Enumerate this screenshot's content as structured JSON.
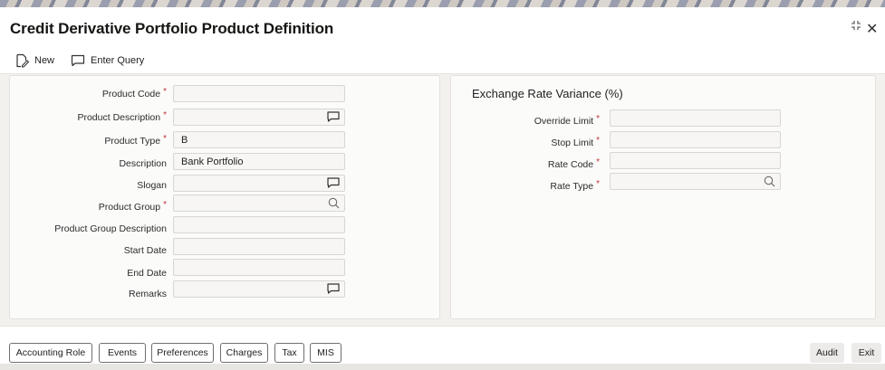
{
  "window": {
    "title": "Credit Derivative Portfolio Product Definition"
  },
  "toolbar": {
    "new_label": "New",
    "enter_query_label": "Enter Query"
  },
  "left_form": {
    "product_code": {
      "label": "Product Code",
      "value": ""
    },
    "product_description": {
      "label": "Product Description",
      "value": ""
    },
    "product_type": {
      "label": "Product Type",
      "value": "B"
    },
    "description": {
      "label": "Description",
      "value": "Bank Portfolio"
    },
    "slogan": {
      "label": "Slogan",
      "value": ""
    },
    "product_group": {
      "label": "Product Group",
      "value": ""
    },
    "product_group_description": {
      "label": "Product Group Description",
      "value": ""
    },
    "start_date": {
      "label": "Start Date",
      "value": ""
    },
    "end_date": {
      "label": "End Date",
      "value": ""
    },
    "remarks": {
      "label": "Remarks",
      "value": ""
    }
  },
  "right_form": {
    "section_title": "Exchange Rate Variance (%)",
    "override_limit": {
      "label": "Override Limit",
      "value": ""
    },
    "stop_limit": {
      "label": "Stop Limit",
      "value": ""
    },
    "rate_code": {
      "label": "Rate Code",
      "value": ""
    },
    "rate_type": {
      "label": "Rate Type",
      "value": ""
    }
  },
  "required_marker": "*",
  "footer": {
    "buttons": [
      "Accounting Role",
      "Events",
      "Preferences",
      "Charges",
      "Tax",
      "MIS"
    ],
    "audit_label": "Audit",
    "exit_label": "Exit"
  },
  "icons": {
    "new": "new-document-icon",
    "enter_query": "chat-bubble-icon",
    "text_expand": "comment-icon",
    "lov": "search-icon",
    "restore": "restore-icon",
    "close": "close-icon"
  },
  "colors": {
    "required": "#c2363b",
    "field_bg": "#f7f6f5",
    "field_border": "#d9d6d1",
    "panel_bg": "#fbfbfa",
    "page_bg": "#f3f1ee"
  }
}
